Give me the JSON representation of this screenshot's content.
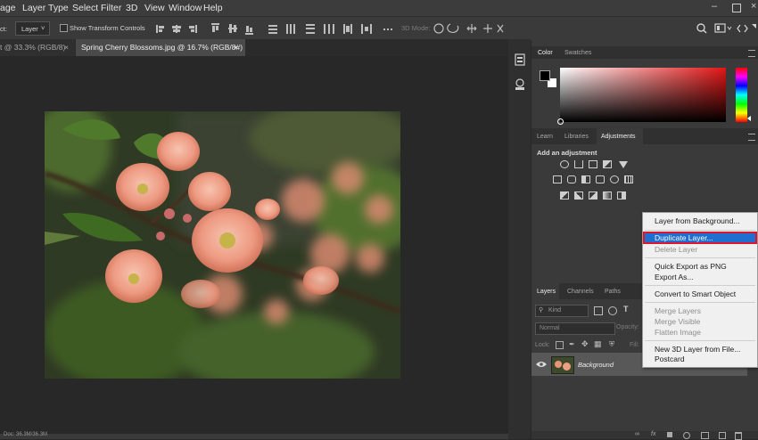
{
  "menu": [
    "age",
    "Layer",
    "Type",
    "Select",
    "Filter",
    "3D",
    "View",
    "Window",
    "Help"
  ],
  "options_bar": {
    "tool_label": "ct:",
    "auto_select_value": "Layer",
    "show_transform_controls": "Show Transform Controls",
    "mode_3d": "3D Mode:"
  },
  "doc_tabs": [
    {
      "label": "t @ 33.3% (RGB/8)",
      "active": false
    },
    {
      "label": "Spring Cherry Blossoms.jpg @ 16.7% (RGB/8#)",
      "active": true
    }
  ],
  "tab_close_glyph": "×",
  "color_panel": {
    "tabs": [
      "Color",
      "Swatches"
    ],
    "active": "Color"
  },
  "adjustments_panel": {
    "tabs": [
      "Learn",
      "Libraries",
      "Adjustments"
    ],
    "active": "Adjustments",
    "heading": "Add an adjustment"
  },
  "layers_panel": {
    "tabs": [
      "Layers",
      "Channels",
      "Paths"
    ],
    "active": "Layers",
    "kind_filter": "Kind",
    "blend_mode": "Normal",
    "opacity_label": "Opacity:",
    "lock_label": "Lock:",
    "fill_label": "Fill:",
    "layers": [
      {
        "name": "Background",
        "visible": true
      }
    ]
  },
  "context_menu": {
    "groups": [
      [
        {
          "label": "Layer from Background...",
          "enabled": true
        }
      ],
      [
        {
          "label": "Duplicate Layer...",
          "enabled": true,
          "highlighted": true
        },
        {
          "label": "Delete Layer",
          "enabled": false
        }
      ],
      [
        {
          "label": "Quick Export as PNG",
          "enabled": true
        },
        {
          "label": "Export As...",
          "enabled": true
        }
      ],
      [
        {
          "label": "Convert to Smart Object",
          "enabled": true
        }
      ],
      [
        {
          "label": "Merge Layers",
          "enabled": false
        },
        {
          "label": "Merge Visible",
          "enabled": false
        },
        {
          "label": "Flatten Image",
          "enabled": false
        }
      ],
      [
        {
          "label": "New 3D Layer from File...",
          "enabled": true
        },
        {
          "label": "Postcard",
          "enabled": true
        }
      ]
    ]
  },
  "status_bar": "Doc: 36.3M/36.3M",
  "colors": {
    "menu_bg": "#3c3c3c",
    "panel_bg": "#3a3a3a",
    "canvas_bg": "#282828",
    "highlight": "#1e6fd0",
    "highlight_outline": "#e0152b",
    "foreground_swatch": "#000000",
    "background_swatch": "#ffffff"
  }
}
